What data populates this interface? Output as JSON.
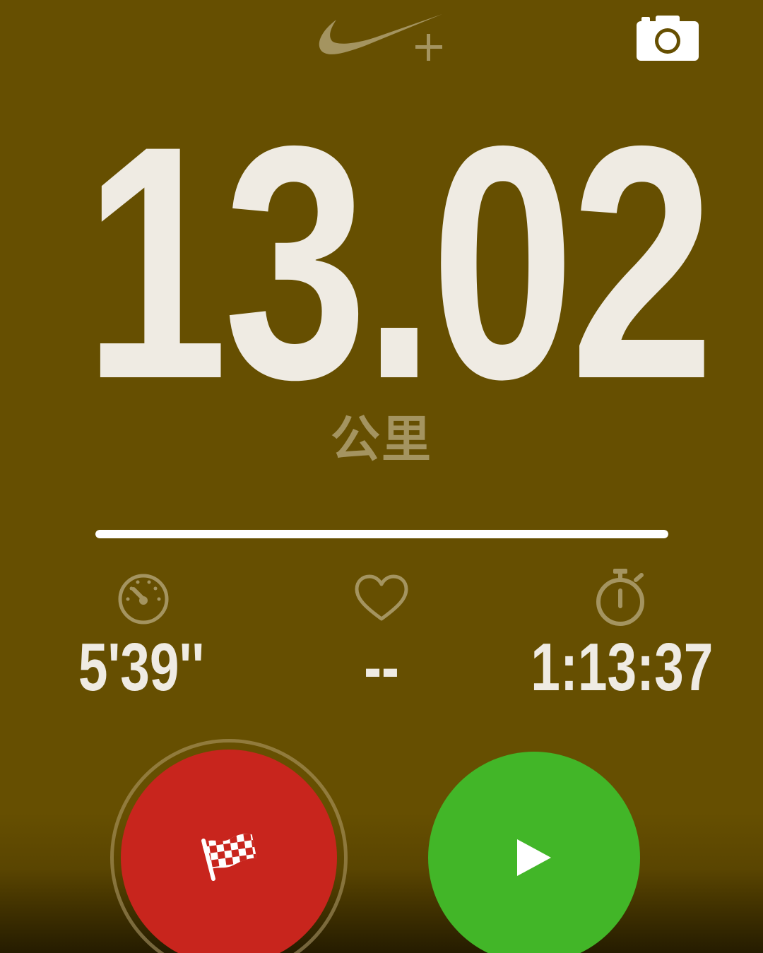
{
  "header": {
    "logo_icon": "nike-plus-logo",
    "camera_icon": "camera-icon"
  },
  "run": {
    "distance": "13.02",
    "distance_unit": "公里",
    "progress_fraction": 1.0
  },
  "stats": {
    "pace": {
      "icon": "speedometer-icon",
      "value": "5'39''"
    },
    "heart_rate": {
      "icon": "heart-icon",
      "value": "--"
    },
    "duration": {
      "icon": "stopwatch-icon",
      "value": "1:13:37"
    }
  },
  "controls": {
    "finish": {
      "icon": "checkered-flag-icon",
      "color": "#c8251d"
    },
    "resume": {
      "icon": "play-icon",
      "color": "#42b628"
    }
  },
  "colors": {
    "background": "#664f01",
    "text_primary": "#efebe3",
    "text_muted": "#a49460"
  }
}
